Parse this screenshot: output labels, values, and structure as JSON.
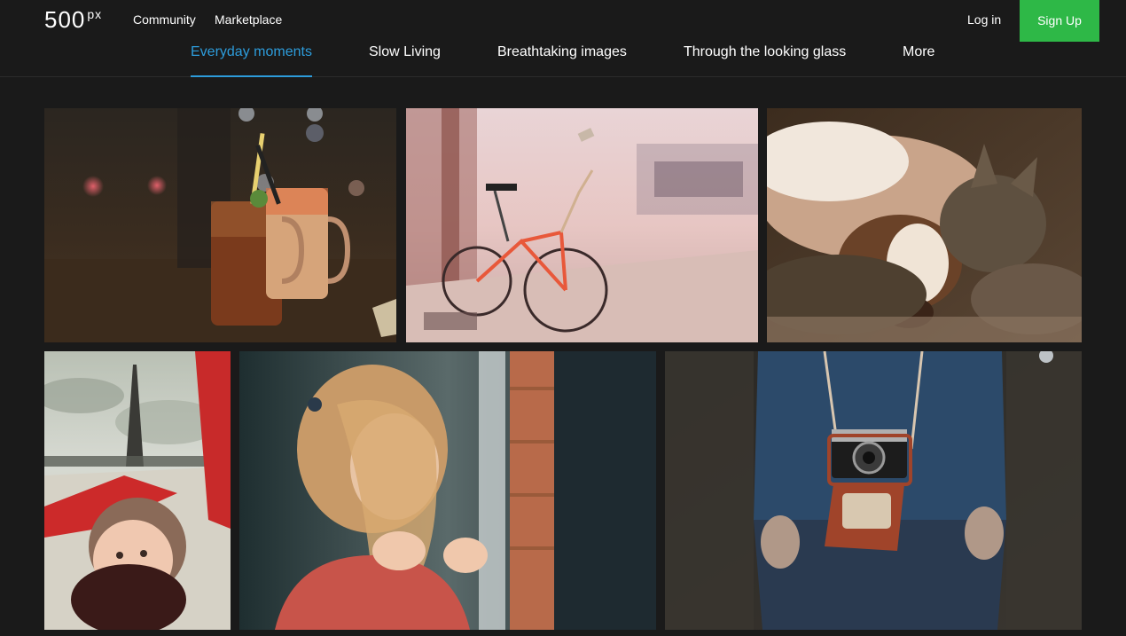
{
  "header": {
    "logo_digits": "500",
    "logo_px": "px",
    "nav": {
      "community": "Community",
      "marketplace": "Marketplace"
    },
    "login_label": "Log in",
    "signup_label": "Sign Up",
    "signup_color": "#2eb847"
  },
  "tabs": [
    {
      "label": "Everyday moments",
      "active": true
    },
    {
      "label": "Slow Living",
      "active": false
    },
    {
      "label": "Breathtaking images",
      "active": false
    },
    {
      "label": "Through the looking glass",
      "active": false
    },
    {
      "label": "More",
      "active": false
    }
  ],
  "accent_color": "#2d9cdb",
  "gallery": {
    "photos": [
      {
        "subject": "iced drinks in mason jars with bokeh lights"
      },
      {
        "subject": "orange bicycle parked on a snowy street"
      },
      {
        "subject": "basset hound and tabby cat sleeping together"
      },
      {
        "subject": "woman lying on ground with Eiffel Tower behind"
      },
      {
        "subject": "girl by a window with hair across her face"
      },
      {
        "subject": "person holding a vintage camera in a leather case"
      }
    ]
  }
}
